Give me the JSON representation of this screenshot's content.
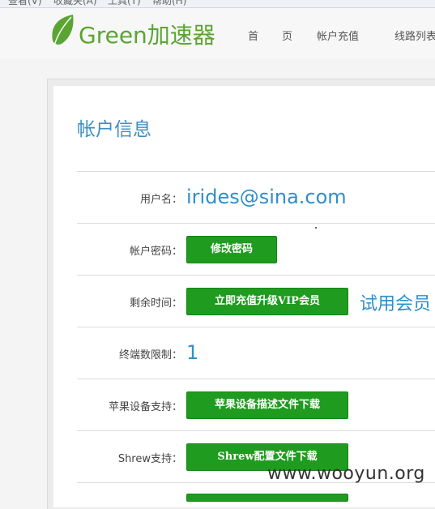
{
  "browser_menu": {
    "items": [
      "查看(V)",
      "收藏夹(A)",
      "工具(T)",
      "帮助(H)"
    ]
  },
  "header": {
    "logo_text": "Green加速器",
    "nav": [
      "首　页",
      "帐户充值",
      "线路列表"
    ]
  },
  "page": {
    "title": "帐户信息"
  },
  "rows": {
    "username": {
      "label": "用户名：",
      "value": "irides@sina.com"
    },
    "password": {
      "label": "帐户密码：",
      "button": "修改密码"
    },
    "remaining": {
      "label": "剩余时间：",
      "button": "立即充值升级VIP会员",
      "member_type": "试用会员"
    },
    "terminals": {
      "label": "终端数限制：",
      "value": "1"
    },
    "apple": {
      "label": "苹果设备支持：",
      "button": "苹果设备描述文件下载"
    },
    "shrew": {
      "label": "Shrew支持：",
      "button": "Shrew配置文件下载"
    }
  },
  "watermark": "www.wooyun.org",
  "colors": {
    "brand_green": "#5aa532",
    "button_green": "#1f9b1f",
    "link_blue": "#2f8fc9"
  },
  "icons": {
    "logo": "green-leaf-icon"
  }
}
